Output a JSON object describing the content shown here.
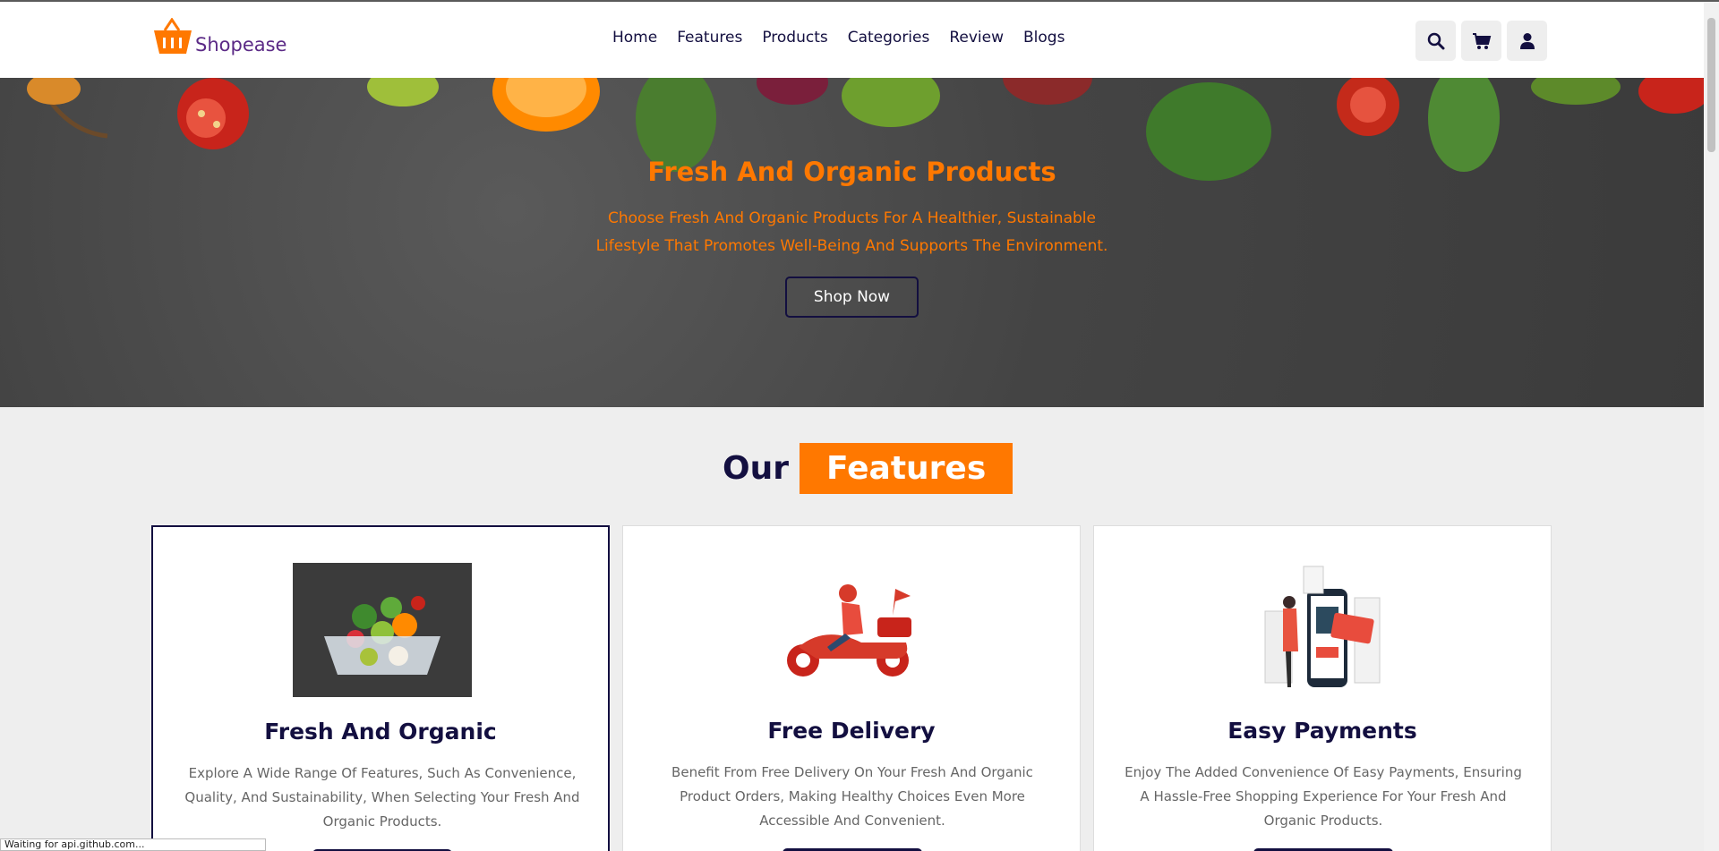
{
  "header": {
    "logo_text": "Shopease",
    "nav": [
      "Home",
      "Features",
      "Products",
      "Categories",
      "Review",
      "Blogs"
    ],
    "icons": [
      "search-icon",
      "cart-icon",
      "user-icon"
    ]
  },
  "hero": {
    "title": "Fresh And Organic Products",
    "subtitle": "Choose Fresh And Organic Products For A Healthier, Sustainable Lifestyle That Promotes Well-Being And Supports The Environment.",
    "button": "Shop Now"
  },
  "features": {
    "heading_part1": "Our",
    "heading_part2": "Features",
    "cards": [
      {
        "title": "Fresh And Organic",
        "text": "Explore A Wide Range Of Features, Such As Convenience, Quality, And Sustainability, When Selecting Your Fresh And Organic Products."
      },
      {
        "title": "Free Delivery",
        "text": "Benefit From Free Delivery On Your Fresh And Organic Product Orders, Making Healthy Choices Even More Accessible And Convenient."
      },
      {
        "title": "Easy Payments",
        "text": "Enjoy The Added Convenience Of Easy Payments, Ensuring A Hassle-Free Shopping Experience For Your Fresh And Organic Products."
      }
    ]
  },
  "status_bar": "Waiting for api.github.com...",
  "colors": {
    "accent": "#ff7800",
    "dark": "#130f40",
    "logo": "#5b2a86"
  }
}
